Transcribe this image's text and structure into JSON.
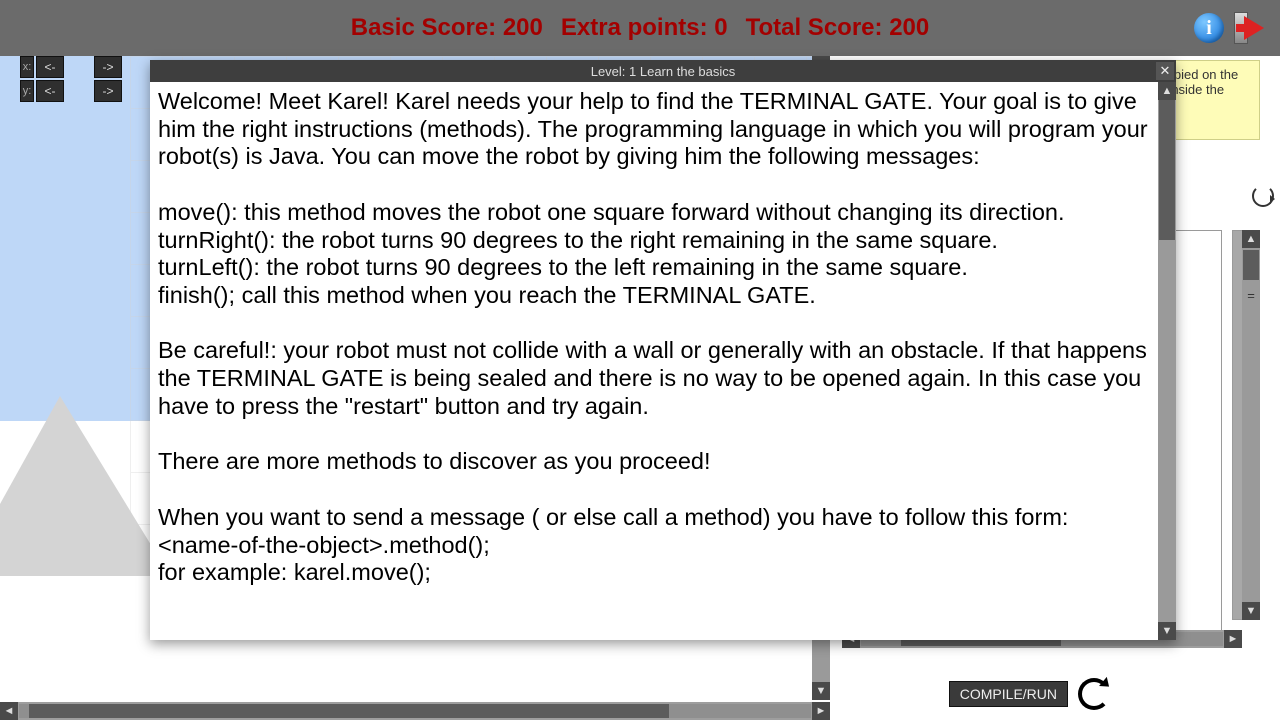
{
  "scores": {
    "basic_label": "Basic Score:",
    "basic_value": "200",
    "extra_label": "Extra points:",
    "extra_value": "0",
    "total_label": "Total Score:",
    "total_value": "200"
  },
  "topbar": {
    "info_tooltip": "i",
    "exit_tooltip": "Exit"
  },
  "pad": {
    "x_label": "x:",
    "y_label": "y:",
    "left": "<-",
    "right": "->"
  },
  "hint": {
    "text": ", the name of the method is copied on the clipboard. Paste it (CTRL+V) inside the editor"
  },
  "dialog": {
    "title": "Level: 1 Learn the basics",
    "body": "Welcome! Meet Karel! Karel needs your help to find the TERMINAL GATE. Your goal is to give him the right instructions (methods). The programming language in which you will program your robot(s) is Java. You can move the robot by giving him the following messages:\n\nmove(): this method moves the robot one square forward without changing its direction.\nturnRight(): the robot turns 90 degrees to the right remaining in the same square.\nturnLeft(): the robot turns 90 degrees to the left remaining in the same square.\nfinish(); call this method when you reach the TERMINAL GATE.\n\nBe careful!: your robot must not collide with a wall or generally with an obstacle. If that happens the TERMINAL GATE is being sealed and there is no way to be opened again. In this case you have to press the \"restart\" button and try again.\n\nThere are more methods to discover as you proceed!\n\nWhen you want to send a message ( or else call a method) you have to follow this form:\n<name-of-the-object>.method();\nfor example: karel.move();\n"
  },
  "compile": {
    "label": "COMPILE/RUN"
  },
  "scroll": {
    "up": "▲",
    "down": "▼",
    "left": "◄",
    "right": "►"
  },
  "rightpanel": {
    "eq": "="
  }
}
